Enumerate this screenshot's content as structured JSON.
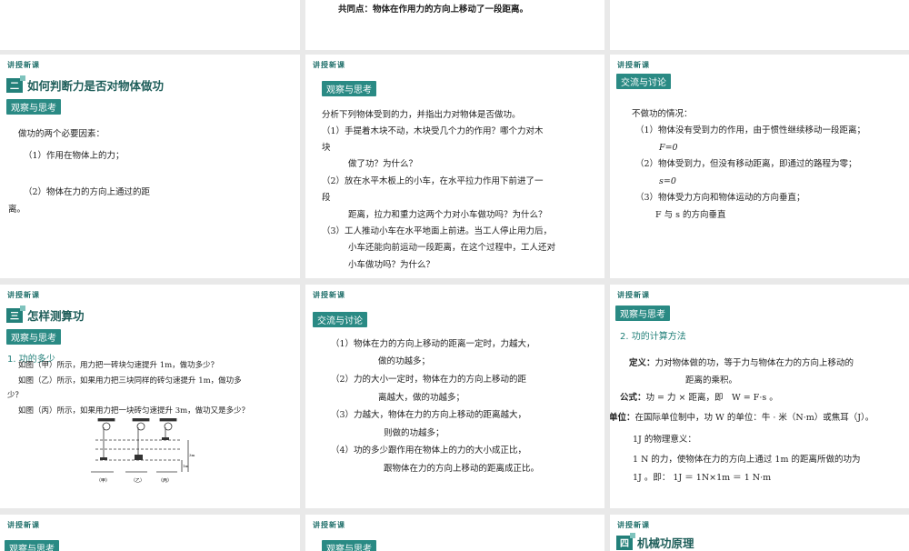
{
  "kicker": "讲授新课",
  "s_top_mid": {
    "text": "共同点：物体在作用力的方向上移动了一段距离。"
  },
  "s2a": {
    "num": "二",
    "title": "如何判断力是否对物体做功",
    "tag": "观察与思考",
    "lines": [
      "做功的两个必要因素：",
      "（1）作用在物体上的力；",
      "（2）物体在力的方向上通过的距",
      "离。"
    ]
  },
  "s2b": {
    "tag": "观察与思考",
    "lines": [
      "分析下列物体受到的力，并指出力对物体是否做功。",
      "（1）手提着木块不动，木块受几个力的作用？哪个力对木",
      "块",
      "做了功？为什么？",
      "（2）放在水平木板上的小车，在水平拉力作用下前进了一",
      "段",
      "距离，拉力和重力这两个力对小车做功吗？为什么？",
      "（3）工人推动小车在水平地面上前进。当工人停止用力后，",
      "小车还能向前运动一段距离，在这个过程中，工人还对",
      "小车做功吗？为什么？"
    ]
  },
  "s2c": {
    "tag": "交流与讨论",
    "lines": [
      "不做功的情况：",
      "（1）物体没有受到力的作用，由于惯性继续移动一段距离；",
      "F=0",
      "（2）物体受到力，但没有移动距离，即通过的路程为零；",
      "s=0",
      "（3）物体受力方向和物体运动的方向垂直；",
      "F 与 s 的方向垂直"
    ]
  },
  "s3a": {
    "num": "三",
    "title": "怎样测算功",
    "tag": "观察与思考",
    "sub": "1. 功的多少",
    "lines": [
      "如图（甲）所示，用力把一砖块匀速提升 1m，做功多少？",
      "如图（乙）所示，如果用力把三块同样的砖匀速提升 1m，做功多",
      "少？",
      "如图（丙）所示，如果用力把一块砖匀速提升 3m，做功又是多少？"
    ],
    "fig": [
      "（甲）",
      "（乙）",
      "（丙）",
      "3m",
      "1m"
    ]
  },
  "s3b": {
    "tag": "交流与讨论",
    "lines": [
      "（1）物体在力的方向上移动的距离一定时，力越大，",
      "做的功越多；",
      "（2）力的大小一定时，物体在力的方向上移动的距",
      "离越大，做的功越多；",
      "（3）力越大，物体在力的方向上移动的距离越大，",
      "则做的功越多；",
      "（4）功的多少跟作用在物体上的力的大小成正比，",
      "跟物体在力的方向上移动的距离成正比。"
    ]
  },
  "s3c": {
    "tag": "观察与思考",
    "sub": "2. 功的计算方法",
    "def_label": "定义：",
    "def": "力对物体做的功，等于力与物体在力的方向上移动的",
    "def2": "距离的乘积。",
    "formula_label": "公式：",
    "formula": "功 = 力 × 距离，即　W = F·s 。",
    "unit_label": "单位：",
    "unit": "在国际单位制中，功 W 的单位：牛 · 米（N·m）或焦耳（J）。",
    "l1": "1J 的物理意义：",
    "l2": "1 N 的力，使物体在力的方向上通过 1m 的距离所做的功为",
    "l3": "1J 。即： 1J ＝ 1N×1m ＝ 1 N·m"
  },
  "s4a": {
    "tag": "观察与思考"
  },
  "s4b": {
    "tag": "观察与思考"
  },
  "s4c": {
    "num": "四",
    "title": "机械功原理"
  }
}
